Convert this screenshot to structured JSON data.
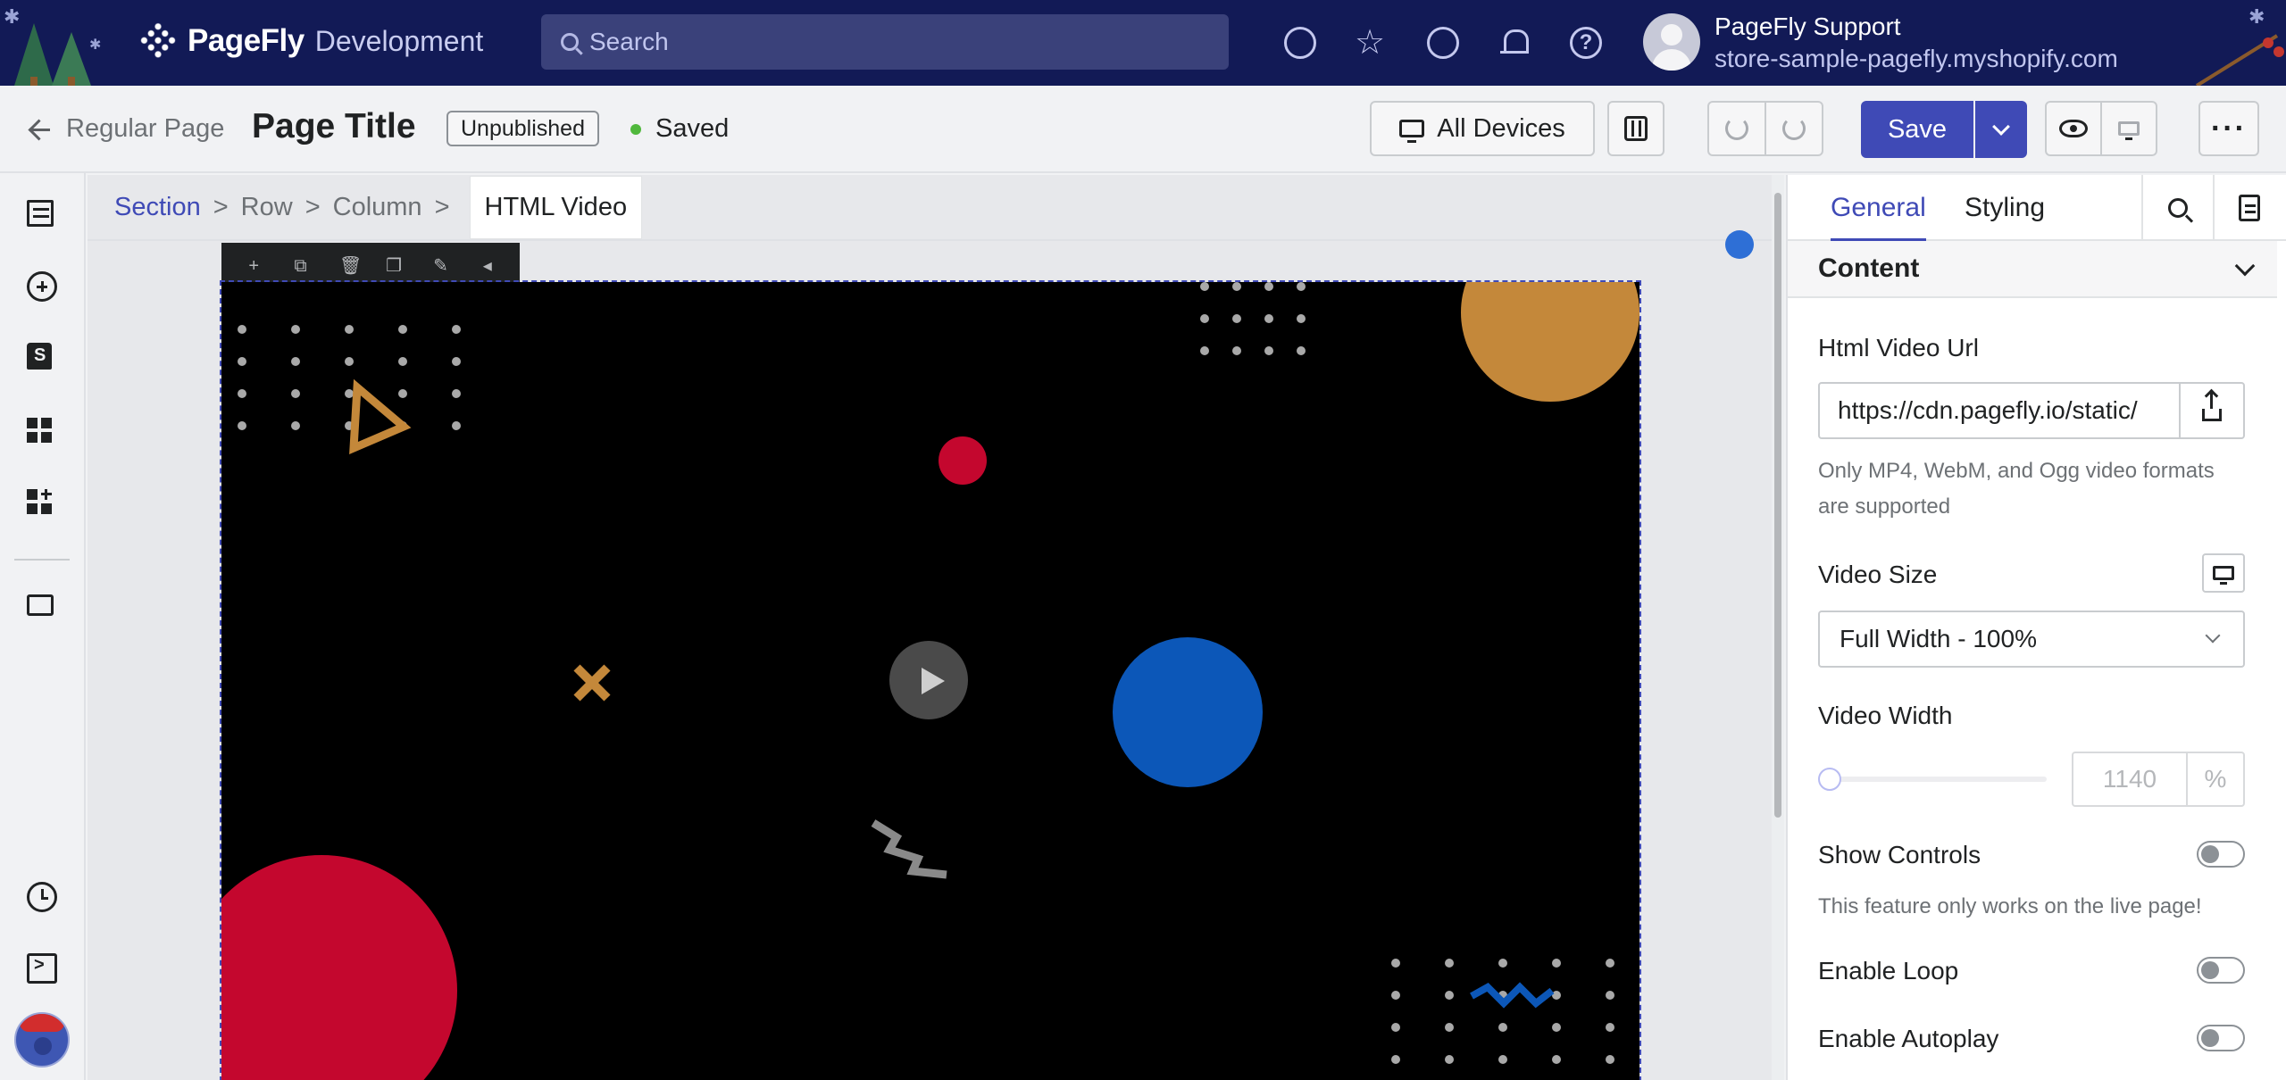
{
  "topbar": {
    "brand": "PageFly",
    "brand_sub": "Development",
    "search_placeholder": "Search",
    "user_name": "PageFly Support",
    "store": "store-sample-pagefly.myshopify.com",
    "bg_color": "#121a56"
  },
  "header": {
    "back_label": "Regular Page",
    "page_title": "Page Title",
    "status_badge": "Unpublished",
    "saved_label": "Saved",
    "devices_label": "All Devices",
    "save_label": "Save",
    "accent_color": "#3f4ab6"
  },
  "breadcrumb": {
    "items": [
      "Section",
      "Row",
      "Column"
    ],
    "current": "HTML Video",
    "separator": ">"
  },
  "element_toolbar": {
    "icons": [
      "add-icon",
      "duplicate-icon",
      "delete-icon",
      "copy-icon",
      "style-icon",
      "collapse-icon"
    ]
  },
  "panel": {
    "tabs": [
      "General",
      "Styling"
    ],
    "section_title": "Content",
    "video_url_label": "Html Video Url",
    "video_url_value": "https://cdn.pagefly.io/static/",
    "video_url_help": "Only MP4, WebM, and Ogg video formats are supported",
    "video_size_label": "Video Size",
    "video_size_value": "Full Width - 100%",
    "video_width_label": "Video Width",
    "video_width_value": "1140",
    "video_width_unit": "%",
    "show_controls_label": "Show Controls",
    "show_controls_help": "This feature only works on the live page!",
    "enable_loop_label": "Enable Loop",
    "enable_autoplay_label": "Enable Autoplay",
    "show_controls_on": false,
    "enable_loop_on": false,
    "enable_autoplay_on": false
  }
}
